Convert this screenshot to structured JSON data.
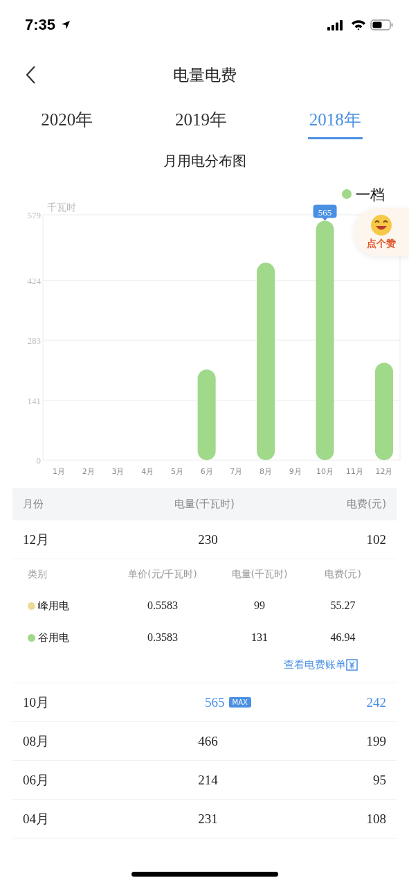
{
  "status_bar": {
    "time": "7:35"
  },
  "nav": {
    "title": "电量电费"
  },
  "tabs": [
    {
      "label": "2020年",
      "selected": false
    },
    {
      "label": "2019年",
      "selected": false
    },
    {
      "label": "2018年",
      "selected": true
    }
  ],
  "chart_title": "月用电分布图",
  "chart": {
    "chart_data": {
      "type": "bar",
      "ylabel": "千瓦时",
      "categories": [
        "1月",
        "2月",
        "3月",
        "4月",
        "5月",
        "6月",
        "7月",
        "8月",
        "9月",
        "10月",
        "11月",
        "12月"
      ],
      "series": [
        {
          "name": "一档",
          "color": "#a0d98a",
          "values": [
            0,
            0,
            0,
            0,
            0,
            214,
            0,
            466,
            0,
            565,
            0,
            230
          ]
        }
      ],
      "ylim": [
        0,
        579
      ],
      "yticks": [
        0,
        141,
        283,
        424,
        579
      ],
      "grid": true,
      "annotations": [
        {
          "x": "10月",
          "y": 565,
          "text": "565"
        }
      ]
    }
  },
  "like_button": {
    "label": "点个赞"
  },
  "table": {
    "columns": [
      "月份",
      "电量(千瓦时)",
      "电费(元)"
    ],
    "rows": [
      {
        "month": "12月",
        "usage": "230",
        "fee": "102",
        "max": false,
        "detail": {
          "columns": [
            "类别",
            "单价(元/千瓦时)",
            "电量(千瓦时)",
            "电费(元)"
          ],
          "rows": [
            {
              "name": "峰用电",
              "color": "#eedc96",
              "price": "0.5583",
              "usage": "99",
              "fee": "55.27"
            },
            {
              "name": "谷用电",
              "color": "#a0d98a",
              "price": "0.3583",
              "usage": "131",
              "fee": "46.94"
            }
          ],
          "link": "查看电费账单"
        }
      },
      {
        "month": "10月",
        "usage": "565",
        "fee": "242",
        "max": true,
        "badge": "MAX"
      },
      {
        "month": "08月",
        "usage": "466",
        "fee": "199",
        "max": false
      },
      {
        "month": "06月",
        "usage": "214",
        "fee": "95",
        "max": false
      },
      {
        "month": "04月",
        "usage": "231",
        "fee": "108",
        "max": false
      }
    ]
  }
}
